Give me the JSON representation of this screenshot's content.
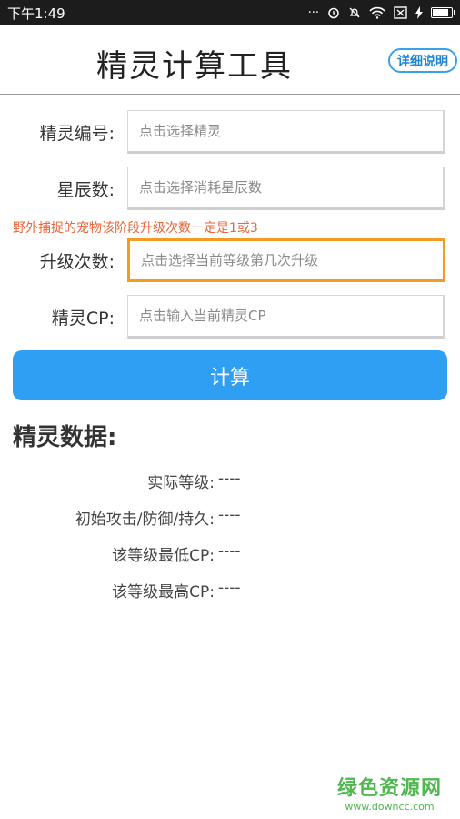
{
  "status_bar": {
    "time": "下午1:49",
    "dots": "···",
    "battery_level": 0.9,
    "icons": [
      "alarm-icon",
      "mute-icon",
      "wifi-icon",
      "sim-icon",
      "charge-icon",
      "battery-icon"
    ]
  },
  "header": {
    "title": "精灵计算工具",
    "help_label": "详细说明"
  },
  "form": {
    "sprite_id_label": "精灵编号:",
    "sprite_id_placeholder": "点击选择精灵",
    "stardust_label": "星辰数:",
    "stardust_placeholder": "点击选择消耗星辰数",
    "hint": "野外捕捉的宠物该阶段升级次数一定是1或3",
    "upgrade_label": "升级次数:",
    "upgrade_placeholder": "点击选择当前等级第几次升级",
    "cp_label": "精灵CP:",
    "cp_placeholder": "点击输入当前精灵CP"
  },
  "calc_button": "计算",
  "results": {
    "title": "精灵数据:",
    "rows": [
      {
        "label": "实际等级:",
        "value": "----"
      },
      {
        "label": "初始攻击/防御/持久:",
        "value": "----"
      },
      {
        "label": "该等级最低CP:",
        "value": "----"
      },
      {
        "label": "该等级最高CP:",
        "value": "----"
      }
    ]
  },
  "watermark": {
    "name": "绿色资源网",
    "url": "www.downcc.com"
  },
  "colors": {
    "accent": "#2e9ff3",
    "focus": "#f59a23",
    "hint": "#e8673a",
    "watermark": "#4fb84f"
  }
}
